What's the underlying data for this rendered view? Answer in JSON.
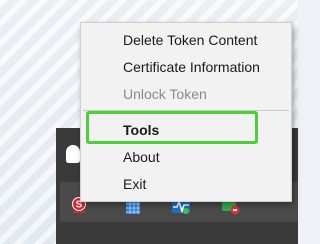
{
  "context_menu": {
    "items": [
      {
        "label": "Delete Token Content",
        "enabled": true
      },
      {
        "label": "Certificate Information",
        "enabled": true
      },
      {
        "label": "Unlock Token",
        "enabled": false
      },
      {
        "label": "Tools",
        "enabled": true,
        "bold": true,
        "highlighted": true
      },
      {
        "label": "About",
        "enabled": true
      },
      {
        "label": "Exit",
        "enabled": true
      }
    ]
  },
  "colors": {
    "highlight_border": "#4ccf3a",
    "menu_background": "#f2f2f2",
    "taskbar": "#3a3a3a",
    "safenet_red": "#d9262b"
  },
  "tray_icons": [
    "safenet-token-icon",
    "network-grid-icon",
    "activity-monitor-icon",
    "chat-app-icon"
  ]
}
